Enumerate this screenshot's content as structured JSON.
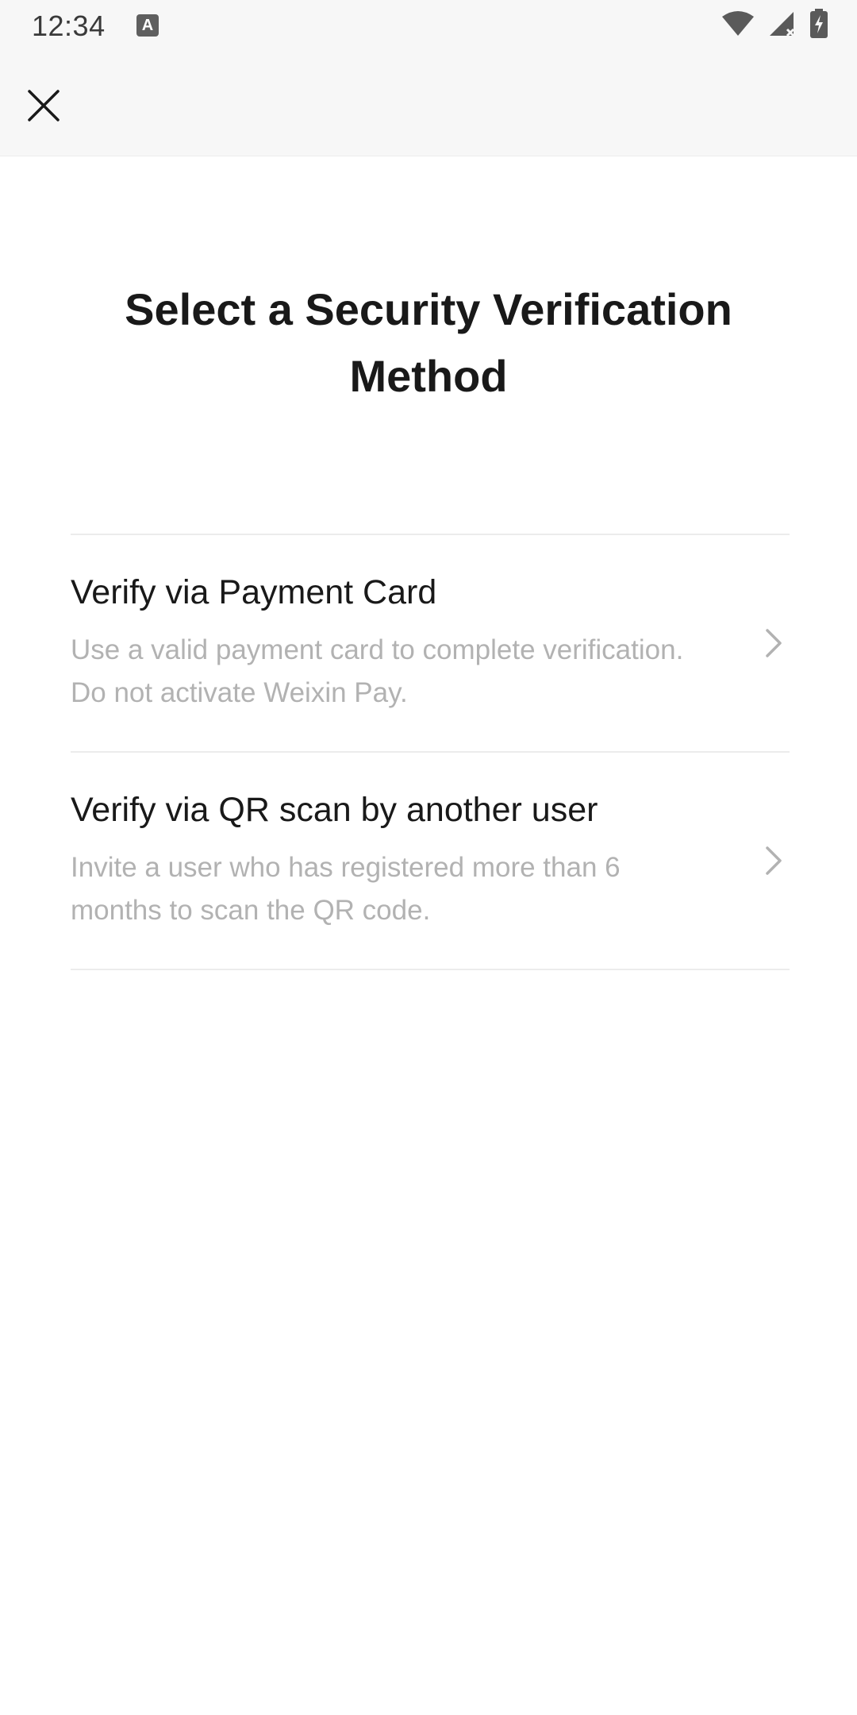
{
  "status_bar": {
    "time": "12:34",
    "app_icon_letter": "A",
    "icons": [
      "wifi-icon",
      "cell-signal-icon",
      "battery-charging-icon"
    ]
  },
  "top_bar": {
    "close_icon": "close-icon"
  },
  "page": {
    "title": "Select a Security Verification Method"
  },
  "options": [
    {
      "title": "Verify via Payment Card",
      "description": "Use a valid payment card to complete verification. Do not activate Weixin Pay.",
      "icon": "chevron-right-icon"
    },
    {
      "title": "Verify via QR scan by another user",
      "description": "Invite a user who has registered more than 6 months to scan the QR code.",
      "icon": "chevron-right-icon"
    }
  ],
  "colors": {
    "background": "#ffffff",
    "header_background": "#f7f7f7",
    "title_text": "#191919",
    "secondary_text": "#b2b2b2",
    "divider": "#ececec"
  }
}
